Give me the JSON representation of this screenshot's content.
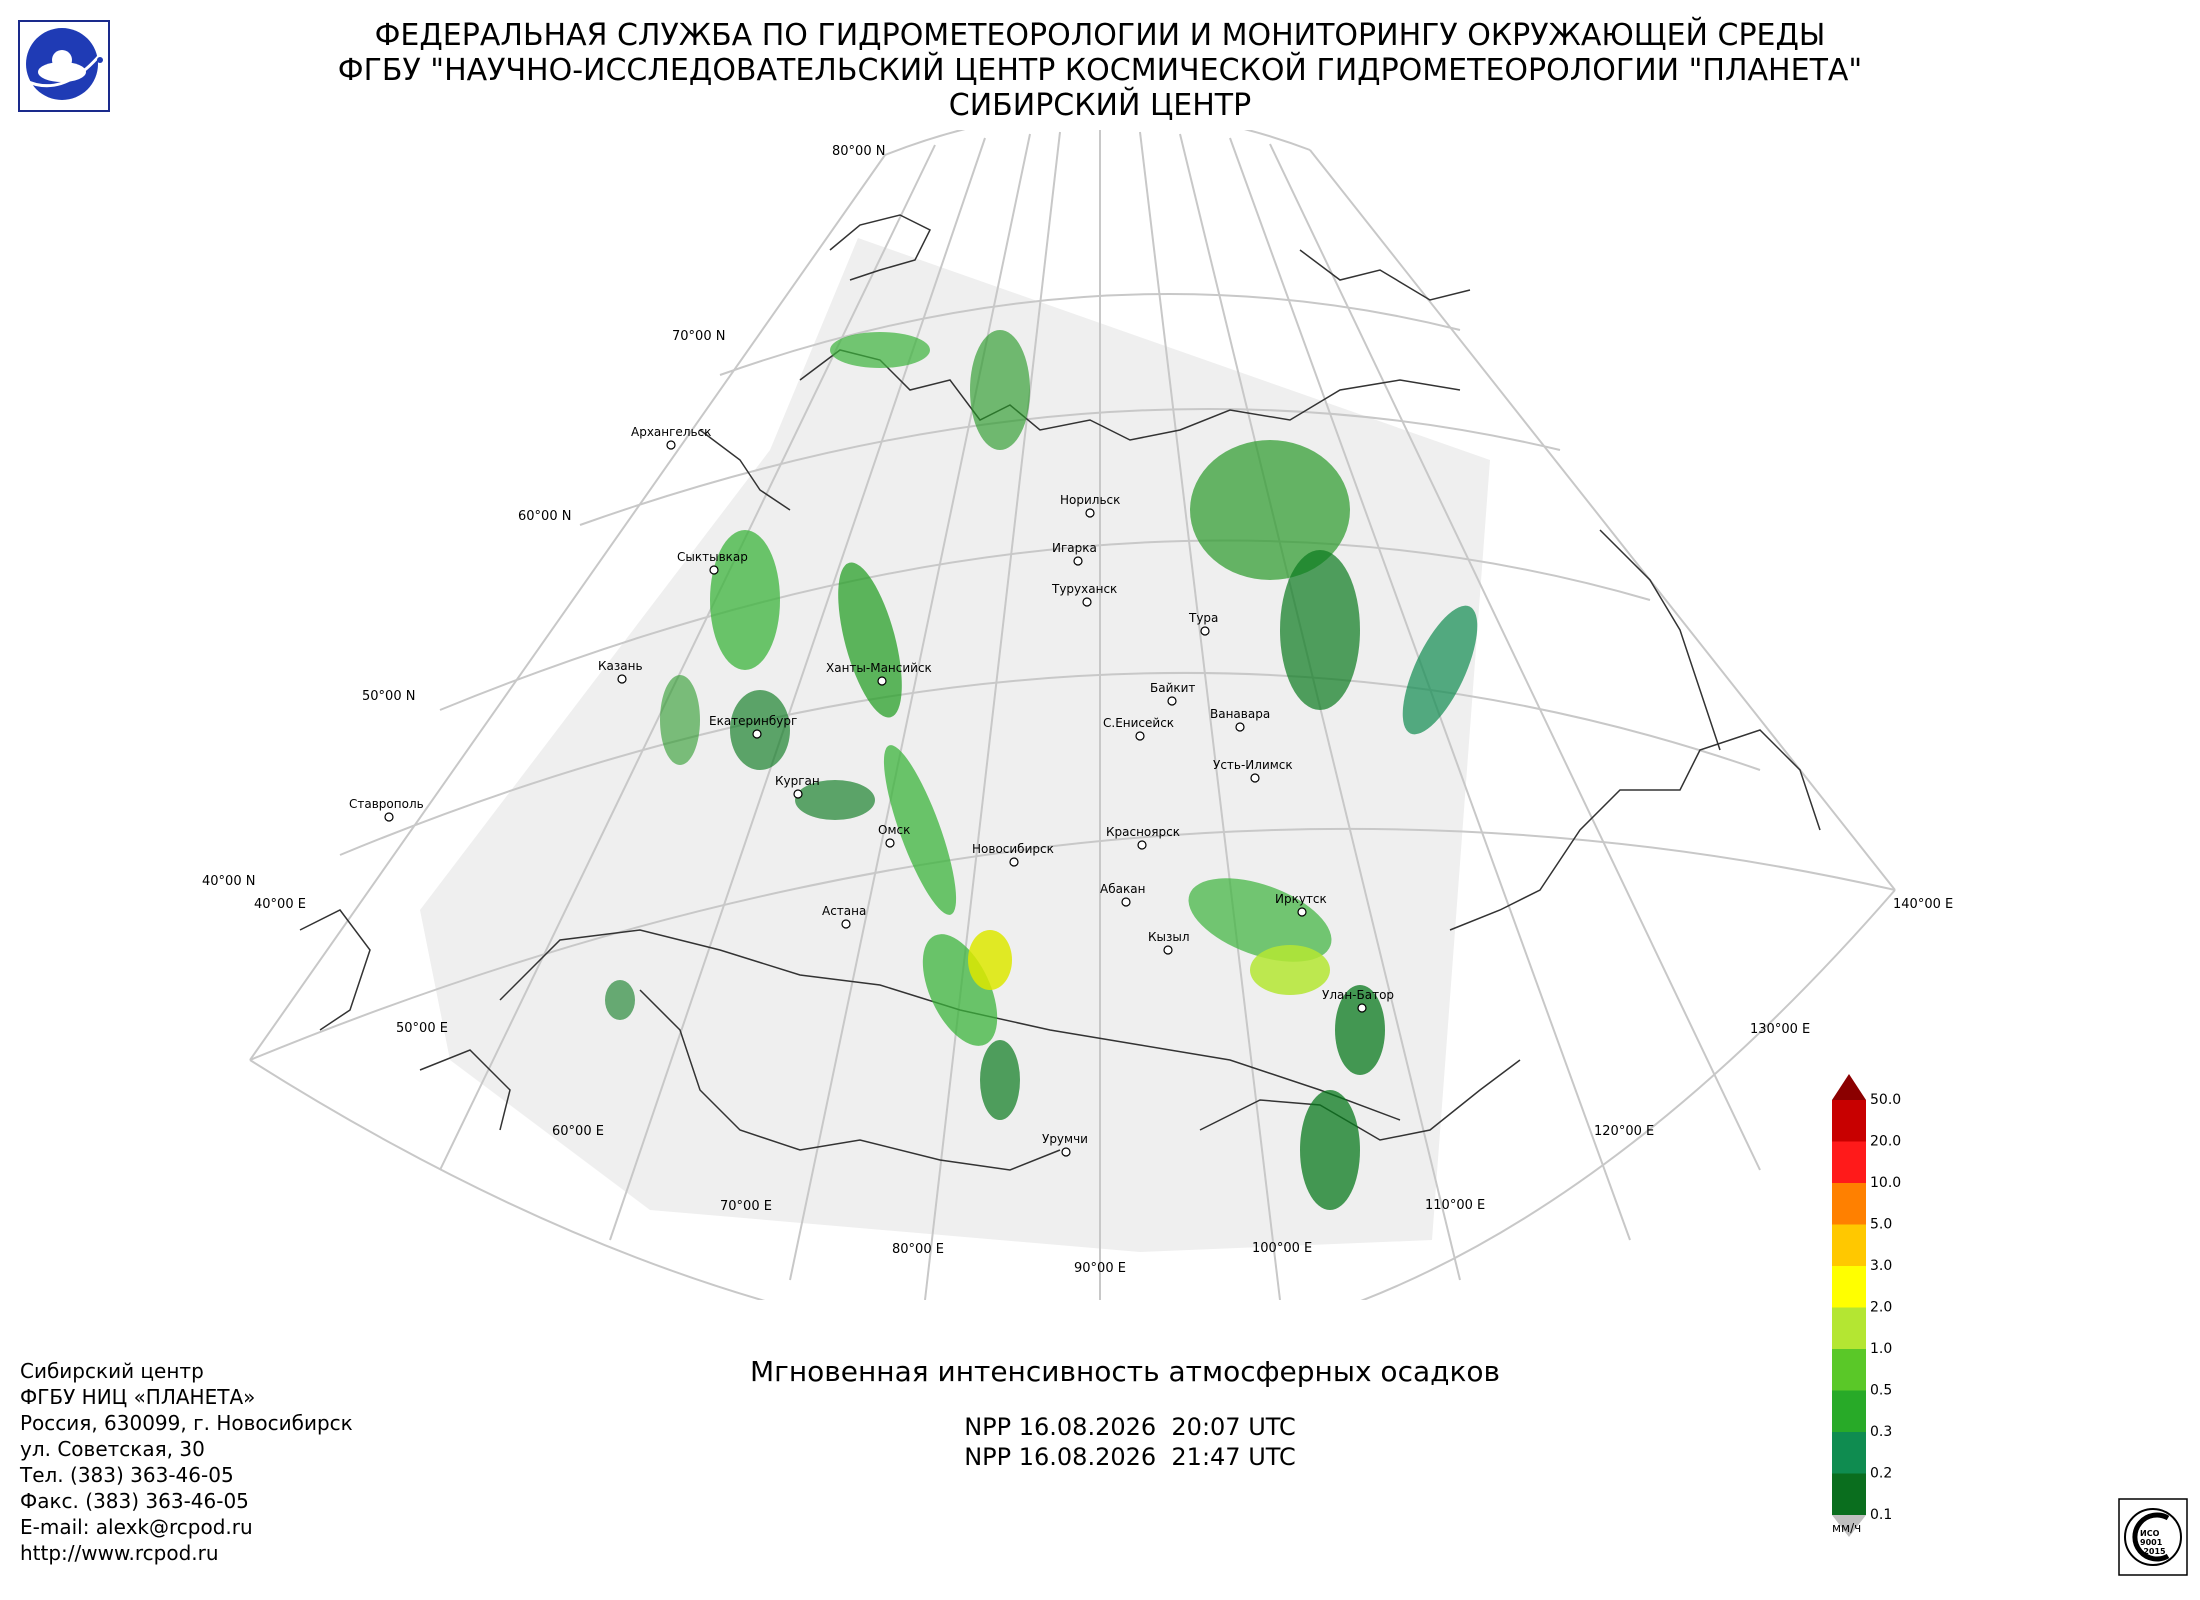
{
  "header": {
    "line1": "ФЕДЕРАЛЬНАЯ СЛУЖБА ПО ГИДРОМЕТЕОРОЛОГИИ И МОНИТОРИНГУ ОКРУЖАЮЩЕЙ СРЕДЫ",
    "line2": "ФГБУ \"НАУЧНО-ИССЛЕДОВАТЕЛЬСКИЙ ЦЕНТР КОСМИЧЕСКОЙ ГИДРОМЕТЕОРОЛОГИИ \"ПЛАНЕТА\"",
    "line3": "СИБИРСКИЙ ЦЕНТР"
  },
  "icons": {
    "logo": "planeta-logo-icon",
    "iso": "iso-9001-certification-seal-icon"
  },
  "colors": {
    "frame": "#c8c8c8",
    "coverage": "#efefef",
    "coast": "#333333",
    "precip_low": "#0a7a1e",
    "precip_mid": "#3cb43c",
    "precip_high": "#dde800"
  },
  "grid": {
    "lat_labels": [
      "80°00 N",
      "70°00 N",
      "60°00 N",
      "50°00 N",
      "40°00 N"
    ],
    "lon_labels": [
      "40°00 E",
      "50°00 E",
      "60°00 E",
      "70°00 E",
      "80°00 E",
      "90°00 E",
      "100°00 E",
      "110°00 E",
      "120°00 E",
      "130°00 E",
      "140°00 E"
    ]
  },
  "cities": [
    "Архангельск",
    "Сыктывкар",
    "Казань",
    "Екатеринбург",
    "Курган",
    "Ставрополь",
    "Ханты-Мансийск",
    "Омск",
    "Новосибирск",
    "Астана",
    "Норильск",
    "Игарка",
    "Туруханск",
    "Тура",
    "Байкит",
    "С.Енисейск",
    "Ванавара",
    "Усть-Илимск",
    "Красноярск",
    "Абакан",
    "Кызыл",
    "Иркутск",
    "Улан-Батор",
    "Урумчи"
  ],
  "legend": {
    "unit": "мм/ч",
    "levels": [
      "50.0",
      "20.0",
      "10.0",
      "5.0",
      "3.0",
      "2.0",
      "1.0",
      "0.5",
      "0.3",
      "0.2",
      "0.1"
    ],
    "colors": [
      "#8b0000",
      "#c80000",
      "#ff1a1a",
      "#ff8000",
      "#ffc800",
      "#ffff00",
      "#b4e632",
      "#5ac828",
      "#28aa28",
      "#0f8c50",
      "#0a6e1e"
    ]
  },
  "product": {
    "title": "Мгновенная интенсивность атмосферных осадков",
    "passes": [
      "NPP 16.08.2026  20:07 UTC",
      "NPP 16.08.2026  21:47 UTC"
    ]
  },
  "contacts": [
    "Сибирский центр",
    "ФГБУ НИЦ «ПЛАНЕТА»",
    "Россия, 630099, г. Новосибирск",
    "ул. Советская, 30",
    "Тел. (383) 363-46-05",
    "Факс. (383) 363-46-05",
    "E-mail: alexk@rcpod.ru",
    "http://www.rcpod.ru"
  ]
}
